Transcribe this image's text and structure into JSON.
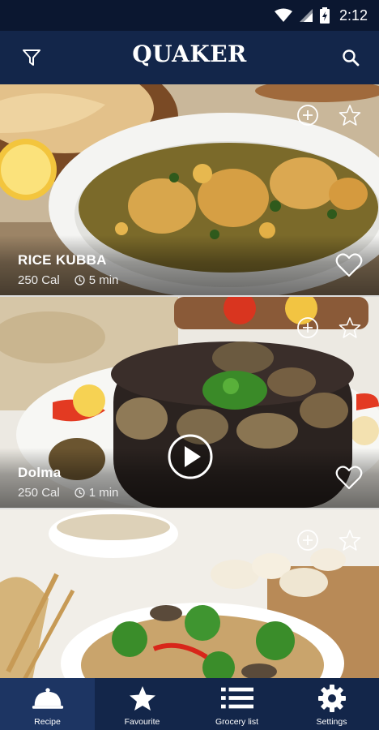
{
  "status_bar": {
    "time": "2:12",
    "icons": [
      "wifi-icon",
      "signal-icon",
      "battery-icon"
    ]
  },
  "header": {
    "brand": "QUAKER",
    "left_icon": "filter-icon",
    "right_icon": "search-icon"
  },
  "recipes": [
    {
      "title": "RICE KUBBA",
      "calories": "250 Cal",
      "time": "5 min",
      "has_video": false,
      "actions": [
        "add-icon",
        "star-icon",
        "heart-icon"
      ]
    },
    {
      "title": "Dolma",
      "calories": "250 Cal",
      "time": "1 min",
      "has_video": true,
      "actions": [
        "add-icon",
        "star-icon",
        "heart-icon",
        "play-icon"
      ]
    },
    {
      "title": "",
      "calories": "",
      "time": "",
      "has_video": false,
      "actions": [
        "add-icon",
        "star-icon"
      ]
    }
  ],
  "bottom_nav": {
    "items": [
      {
        "label": "Recipe",
        "icon": "cloche-icon",
        "active": true
      },
      {
        "label": "Favourite",
        "icon": "star-icon",
        "active": false
      },
      {
        "label": "Grocery list",
        "icon": "list-icon",
        "active": false
      },
      {
        "label": "Settings",
        "icon": "gear-icon",
        "active": false
      }
    ]
  },
  "colors": {
    "status_bar": "#0b1730",
    "app_bar": "#13264a",
    "nav_active": "#1d3563",
    "text_light": "#ffffff"
  }
}
